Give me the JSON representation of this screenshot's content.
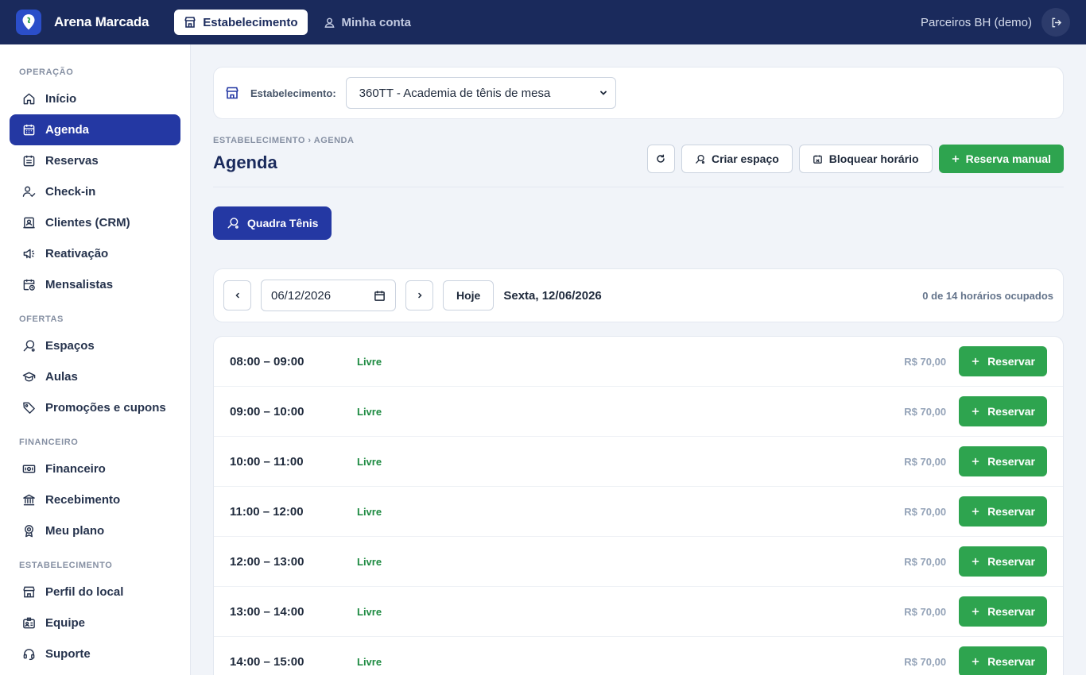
{
  "topbar": {
    "brand": "Arena Marcada",
    "tabs": [
      {
        "label": "Estabelecimento",
        "icon": "store-icon",
        "active": true
      },
      {
        "label": "Minha conta",
        "icon": "user-icon",
        "active": false
      }
    ],
    "user_label": "Parceiros BH (demo)",
    "colors": {
      "bar": "#1a2a5c",
      "accent": "#2438a3",
      "green": "#2ea44f"
    }
  },
  "sidebar": {
    "sections": [
      {
        "title": "OPERAÇÃO",
        "items": [
          {
            "label": "Início",
            "icon": "home-icon"
          },
          {
            "label": "Agenda",
            "icon": "calendar-icon",
            "active": true
          },
          {
            "label": "Reservas",
            "icon": "calendar-list-icon"
          },
          {
            "label": "Check-in",
            "icon": "user-check-icon"
          },
          {
            "label": "Clientes (CRM)",
            "icon": "contacts-icon"
          },
          {
            "label": "Reativação",
            "icon": "megaphone-icon"
          },
          {
            "label": "Mensalistas",
            "icon": "calendar-clock-icon"
          }
        ]
      },
      {
        "title": "OFERTAS",
        "items": [
          {
            "label": "Espaços",
            "icon": "racket-icon"
          },
          {
            "label": "Aulas",
            "icon": "graduation-cap-icon"
          },
          {
            "label": "Promoções e cupons",
            "icon": "tag-icon"
          }
        ]
      },
      {
        "title": "FINANCEIRO",
        "items": [
          {
            "label": "Financeiro",
            "icon": "banknote-icon"
          },
          {
            "label": "Recebimento",
            "icon": "bank-icon"
          },
          {
            "label": "Meu plano",
            "icon": "award-icon"
          }
        ]
      },
      {
        "title": "ESTABELECIMENTO",
        "items": [
          {
            "label": "Perfil do local",
            "icon": "store-icon"
          },
          {
            "label": "Equipe",
            "icon": "id-badge-icon"
          },
          {
            "label": "Suporte",
            "icon": "headset-icon"
          }
        ]
      }
    ]
  },
  "estab": {
    "label": "Estabelecimento:",
    "selected": "360TT - Academia de tênis de mesa"
  },
  "header": {
    "breadcrumb": "ESTABELECIMENTO › AGENDA",
    "title": "Agenda",
    "actions": {
      "create_space": "Criar espaço",
      "block_time": "Bloquear horário",
      "manual_booking": "Reserva manual"
    }
  },
  "space_chip": "Quadra Tênis",
  "date_bar": {
    "date_value": "06/12/2026",
    "today": "Hoje",
    "date_label": "Sexta, 12/06/2026",
    "occupied": "0 de 14 horários ocupados"
  },
  "slots": [
    {
      "time": "08:00 – 09:00",
      "status": "Livre",
      "price": "R$ 70,00",
      "action": "Reservar"
    },
    {
      "time": "09:00 – 10:00",
      "status": "Livre",
      "price": "R$ 70,00",
      "action": "Reservar"
    },
    {
      "time": "10:00 – 11:00",
      "status": "Livre",
      "price": "R$ 70,00",
      "action": "Reservar"
    },
    {
      "time": "11:00 – 12:00",
      "status": "Livre",
      "price": "R$ 70,00",
      "action": "Reservar"
    },
    {
      "time": "12:00 – 13:00",
      "status": "Livre",
      "price": "R$ 70,00",
      "action": "Reservar"
    },
    {
      "time": "13:00 – 14:00",
      "status": "Livre",
      "price": "R$ 70,00",
      "action": "Reservar"
    },
    {
      "time": "14:00 – 15:00",
      "status": "Livre",
      "price": "R$ 70,00",
      "action": "Reservar"
    }
  ]
}
